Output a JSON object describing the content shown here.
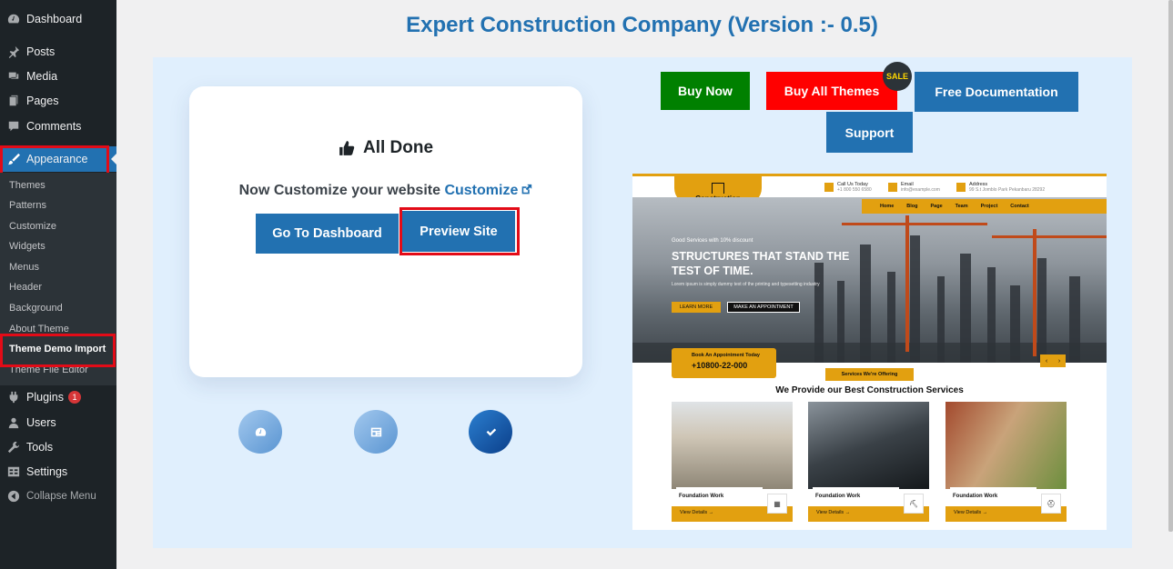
{
  "sidebar": {
    "items": [
      {
        "label": "Dashboard",
        "icon": "dashboard-icon"
      },
      {
        "label": "Posts",
        "icon": "pin-icon"
      },
      {
        "label": "Media",
        "icon": "media-icon"
      },
      {
        "label": "Pages",
        "icon": "pages-icon"
      },
      {
        "label": "Comments",
        "icon": "comment-icon"
      },
      {
        "label": "Appearance",
        "icon": "brush-icon"
      }
    ],
    "submenu": [
      "Themes",
      "Patterns",
      "Customize",
      "Widgets",
      "Menus",
      "Header",
      "Background",
      "About Theme",
      "Theme Demo Import",
      "Theme File Editor"
    ],
    "lower_items": [
      {
        "label": "Plugins",
        "icon": "plugin-icon",
        "badge": "1"
      },
      {
        "label": "Users",
        "icon": "users-icon"
      },
      {
        "label": "Tools",
        "icon": "wrench-icon"
      },
      {
        "label": "Settings",
        "icon": "settings-icon"
      }
    ],
    "collapse_label": "Collapse Menu",
    "active_color": "#2271b1",
    "highlight_color": "#e30b17"
  },
  "main": {
    "title": "Expert Construction Company (Version :- 0.5)",
    "done_card": {
      "heading": "All Done",
      "customize_text": "Now Customize your website",
      "customize_link": "Customize",
      "dashboard_button": "Go To Dashboard",
      "preview_button": "Preview Site"
    },
    "steps": [
      {
        "icon": "dashboard-icon"
      },
      {
        "icon": "layout-icon"
      },
      {
        "icon": "check-icon"
      }
    ],
    "actions": {
      "buy_now": "Buy Now",
      "buy_all": "Buy All Themes",
      "sale": "SALE",
      "docs": "Free Documentation",
      "support": "Support"
    }
  },
  "preview": {
    "logo": "Construction",
    "info": [
      {
        "title": "Call Us Today",
        "sub": "+1 800 550 6580"
      },
      {
        "title": "Email",
        "sub": "info@example.com"
      },
      {
        "title": "Address",
        "sub": "99 S.t Jomblo Park Pekanbaru 28292"
      }
    ],
    "nav": [
      "Home",
      "Blog",
      "Page",
      "Team",
      "Project",
      "Contact"
    ],
    "kicker": "Good Services with 10% discount",
    "headline": "STRUCTURES THAT STAND THE TEST OF TIME.",
    "lorem": "Lorem ipsum is simply dummy text of the printing and typesetting industry",
    "learn_more": "LEARN MORE",
    "make_appointment": "MAKE AN APPOINTMENT",
    "book_label": "Book An Appointment Today",
    "book_phone": "+10800-22-000",
    "services_tag": "Services We're Offering",
    "services_title": "We Provide our Best Construction Services",
    "cards": [
      {
        "label": "Foundation Work",
        "link": "View Details →"
      },
      {
        "label": "Foundation Work",
        "link": "View Details →"
      },
      {
        "label": "Foundation Work",
        "link": "View Details →"
      }
    ],
    "accent_color": "#e2a010"
  }
}
